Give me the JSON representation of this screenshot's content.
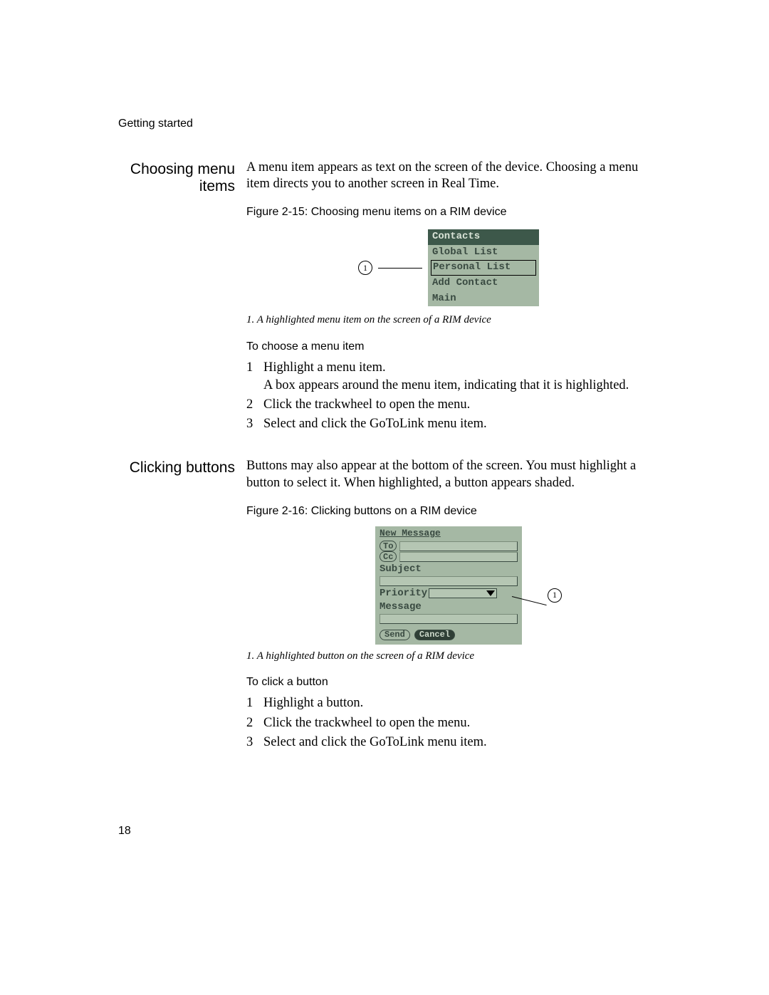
{
  "runningHead": "Getting started",
  "pageNumber": "18",
  "section1": {
    "sideHead": "Choosing menu items",
    "para": "A menu item appears as text on the screen of the device. Choosing a menu item directs you to another screen in Real Time.",
    "figCaption": "Figure 2-15: Choosing menu items on a RIM device",
    "callout": "1",
    "rimHeader": "Contacts",
    "rimItems": [
      "Global List",
      "Personal List",
      "Add Contact",
      "Main"
    ],
    "rimSelectedIndex": 1,
    "figLegend": "1.  A  highlighted menu item on the screen of a RIM  device",
    "subhead": "To choose a menu item",
    "steps": [
      {
        "n": "1",
        "t": "Highlight a menu item.",
        "sub": "A box appears around the menu item, indicating that it is highlighted."
      },
      {
        "n": "2",
        "t": "Click the trackwheel to open the menu."
      },
      {
        "n": "3",
        "t": "Select and click the GoToLink menu item."
      }
    ]
  },
  "section2": {
    "sideHead": "Clicking buttons",
    "para": "Buttons may also appear at the bottom of the screen. You must highlight a button to select it. When highlighted, a button appears shaded.",
    "figCaption": "Figure 2-16: Clicking buttons on a RIM device",
    "callout": "1",
    "rim2Title": "New Message",
    "rim2To": "To",
    "rim2Cc": "Cc",
    "rim2Subject": "Subject",
    "rim2Priority": "Priority",
    "rim2Message": "Message",
    "rim2Send": "Send",
    "rim2Cancel": "Cancel",
    "figLegend": "1.  A  highlighted button on the screen of a RIM  device",
    "subhead": "To click a button",
    "steps": [
      {
        "n": "1",
        "t": "Highlight a button."
      },
      {
        "n": "2",
        "t": "Click the trackwheel to open the menu."
      },
      {
        "n": "3",
        "t": "Select and click the GoToLink menu item."
      }
    ]
  }
}
